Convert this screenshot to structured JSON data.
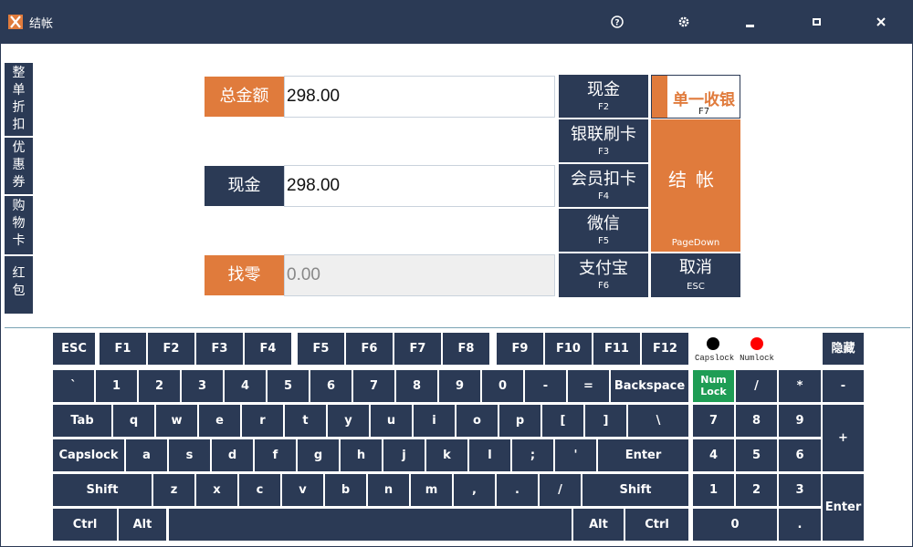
{
  "window": {
    "title": "结帐",
    "help_label": "?",
    "settings_label": "⚙",
    "minimize_label": "▁",
    "maximize_label": "▢",
    "close_label": "✕"
  },
  "sidebar": {
    "items": [
      "整单折扣",
      "优惠券",
      "购物卡",
      "红包"
    ]
  },
  "amounts": {
    "total_label": "总金额",
    "total_value": "298.00",
    "cash_label": "现金",
    "cash_value": "298.00",
    "change_label": "找零",
    "change_value": "0.00"
  },
  "payment_methods": [
    {
      "label": "现金",
      "key": "F2"
    },
    {
      "label": "银联刷卡",
      "key": "F3"
    },
    {
      "label": "会员扣卡",
      "key": "F4"
    },
    {
      "label": "微信",
      "key": "F5"
    },
    {
      "label": "支付宝",
      "key": "F6"
    }
  ],
  "single_payment": {
    "label": "单一收银",
    "key": "F7"
  },
  "checkout": {
    "label": "结帐",
    "key": "PageDown"
  },
  "cancel": {
    "label": "取消",
    "key": "ESC"
  },
  "indicators": {
    "capslock_label": "Capslock",
    "capslock_color": "#000000",
    "numlock_label": "Numlock",
    "numlock_color": "#ff0000"
  },
  "keyboard": {
    "esc": "ESC",
    "fkeys": [
      "F1",
      "F2",
      "F3",
      "F4",
      "F5",
      "F6",
      "F7",
      "F8",
      "F9",
      "F10",
      "F11",
      "F12"
    ],
    "hide": "隐藏",
    "row1": [
      "`",
      "1",
      "2",
      "3",
      "4",
      "5",
      "6",
      "7",
      "8",
      "9",
      "0",
      "-",
      "=",
      "Backspace"
    ],
    "row2": [
      "Tab",
      "q",
      "w",
      "e",
      "r",
      "t",
      "y",
      "u",
      "i",
      "o",
      "p",
      "[",
      "]",
      "\\"
    ],
    "row3": [
      "Capslock",
      "a",
      "s",
      "d",
      "f",
      "g",
      "h",
      "j",
      "k",
      "l",
      ";",
      "'",
      "Enter"
    ],
    "row4": [
      "Shift",
      "z",
      "x",
      "c",
      "v",
      "b",
      "n",
      "m",
      ",",
      ".",
      "/",
      "Shift"
    ],
    "row5": [
      "Ctrl",
      "Alt",
      "",
      "Alt",
      "Ctrl"
    ],
    "numpad": {
      "numlock": "Num Lock",
      "divide": "/",
      "multiply": "*",
      "minus": "-",
      "n7": "7",
      "n8": "8",
      "n9": "9",
      "plus": "+",
      "n4": "4",
      "n5": "5",
      "n6": "6",
      "n1": "1",
      "n2": "2",
      "n3": "3",
      "enter": "Enter",
      "n0": "0",
      "dot": "."
    }
  }
}
